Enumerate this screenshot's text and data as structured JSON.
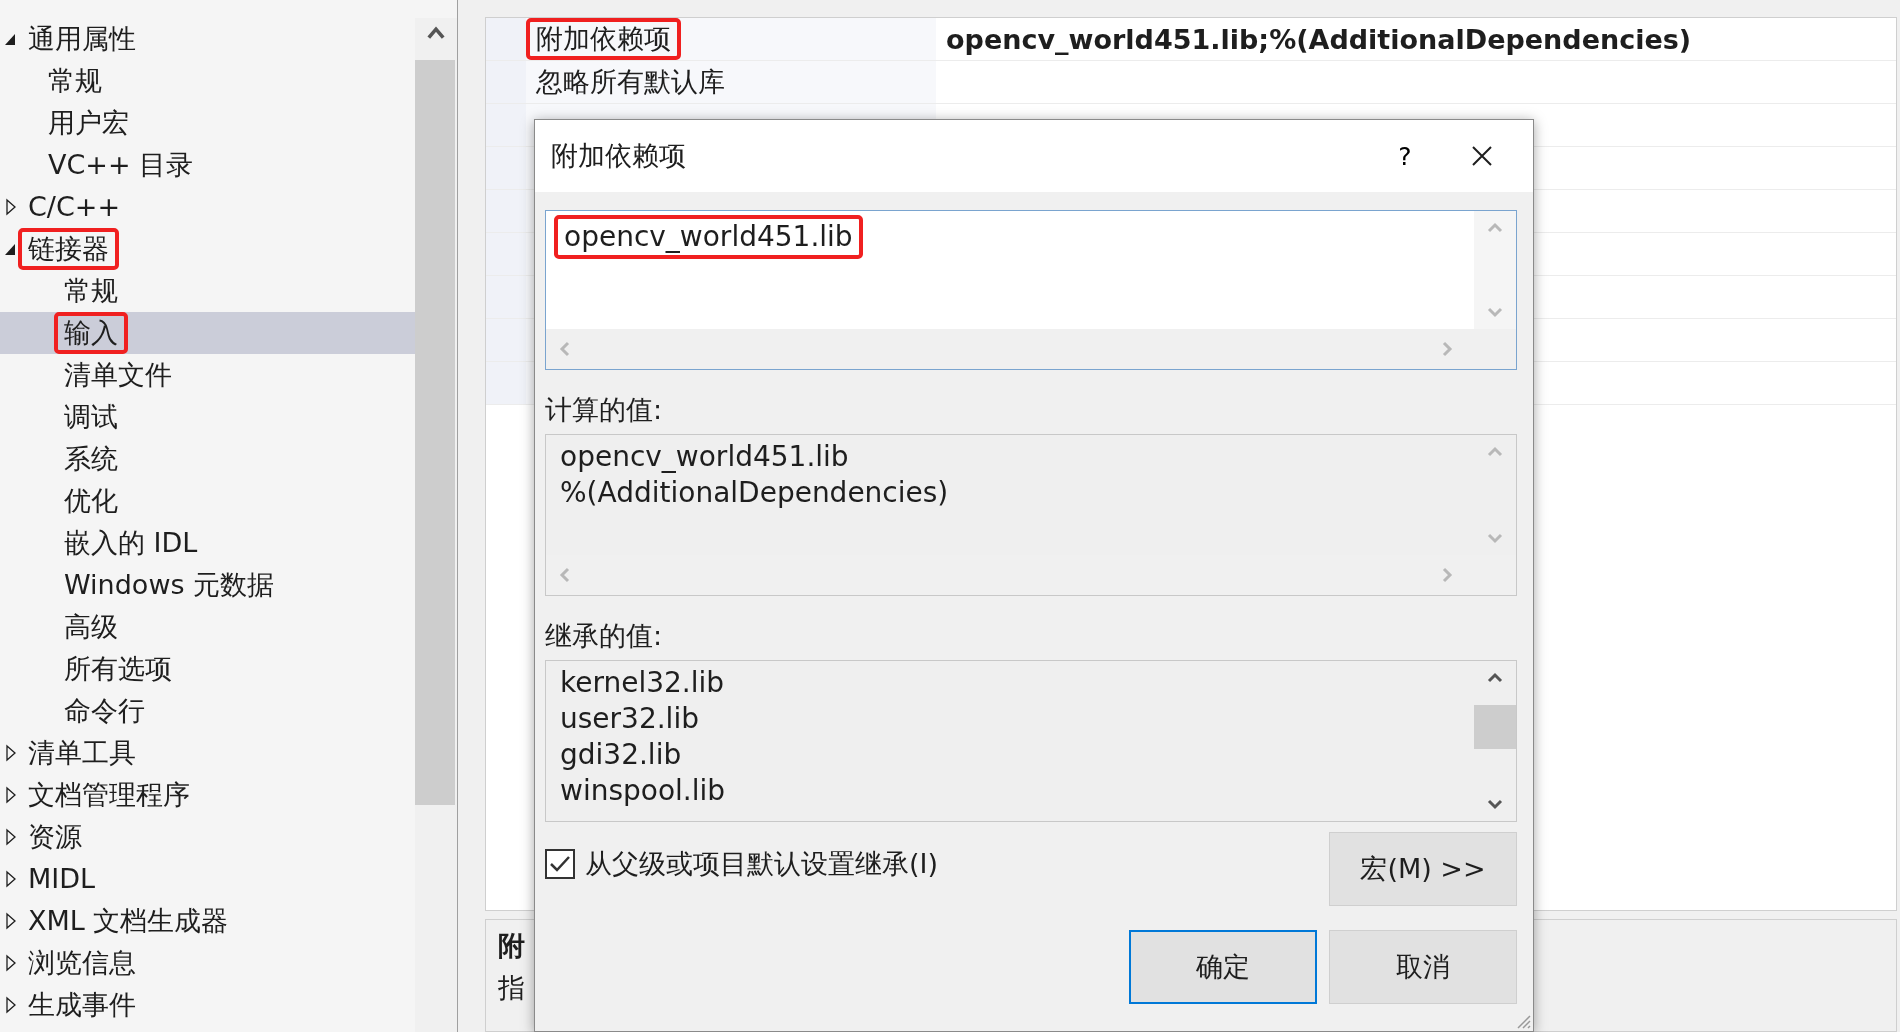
{
  "tree": {
    "items": [
      {
        "label": "通用属性",
        "expanded": true,
        "selected": false,
        "highlighted": false,
        "children": [
          {
            "label": "常规",
            "selected": false,
            "highlighted": false
          },
          {
            "label": "用户宏",
            "selected": false,
            "highlighted": false
          },
          {
            "label": "VC++ 目录",
            "selected": false,
            "highlighted": false
          }
        ]
      },
      {
        "label": "C/C++",
        "expanded": false,
        "selected": false,
        "highlighted": false
      },
      {
        "label": "链接器",
        "expanded": true,
        "selected": false,
        "highlighted": true,
        "children": [
          {
            "label": "常规",
            "selected": false,
            "highlighted": false
          },
          {
            "label": "输入",
            "selected": true,
            "highlighted": true
          },
          {
            "label": "清单文件",
            "selected": false,
            "highlighted": false
          },
          {
            "label": "调试",
            "selected": false,
            "highlighted": false
          },
          {
            "label": "系统",
            "selected": false,
            "highlighted": false
          },
          {
            "label": "优化",
            "selected": false,
            "highlighted": false
          },
          {
            "label": "嵌入的 IDL",
            "selected": false,
            "highlighted": false
          },
          {
            "label": "Windows 元数据",
            "selected": false,
            "highlighted": false
          },
          {
            "label": "高级",
            "selected": false,
            "highlighted": false
          },
          {
            "label": "所有选项",
            "selected": false,
            "highlighted": false
          },
          {
            "label": "命令行",
            "selected": false,
            "highlighted": false
          }
        ]
      },
      {
        "label": "清单工具",
        "expanded": false,
        "selected": false,
        "highlighted": false
      },
      {
        "label": "文档管理程序",
        "expanded": false,
        "selected": false,
        "highlighted": false
      },
      {
        "label": "资源",
        "expanded": false,
        "selected": false,
        "highlighted": false
      },
      {
        "label": "MIDL",
        "expanded": false,
        "selected": false,
        "highlighted": false
      },
      {
        "label": "XML 文档生成器",
        "expanded": false,
        "selected": false,
        "highlighted": false
      },
      {
        "label": "浏览信息",
        "expanded": false,
        "selected": false,
        "highlighted": false
      },
      {
        "label": "生成事件",
        "expanded": false,
        "selected": false,
        "highlighted": false
      }
    ]
  },
  "grid": {
    "rows": [
      {
        "name": "附加依赖项",
        "value": "opencv_world451.lib;%(AdditionalDependencies)",
        "highlighted": true
      },
      {
        "name": "忽略所有默认库",
        "highlighted": false
      }
    ]
  },
  "description": {
    "title": "附",
    "text": "指"
  },
  "dialog": {
    "title": "附加依赖项",
    "help": "?",
    "edit": {
      "lines": [
        "opencv_world451.lib"
      ],
      "highlighted": true
    },
    "computed": {
      "label": "计算的值:",
      "lines": [
        "opencv_world451.lib",
        "%(AdditionalDependencies)"
      ]
    },
    "inherited": {
      "label": "继承的值:",
      "lines": [
        "kernel32.lib",
        "user32.lib",
        "gdi32.lib",
        "winspool.lib"
      ]
    },
    "inherit_checkbox": {
      "label": "从父级或项目默认设置继承(I)",
      "checked": true
    },
    "buttons": [
      {
        "kind": "macro",
        "label": "宏(M) >>",
        "default": false
      },
      {
        "kind": "ok",
        "label": "确定",
        "default": true
      },
      {
        "kind": "cancel",
        "label": "取消",
        "default": false
      }
    ]
  }
}
